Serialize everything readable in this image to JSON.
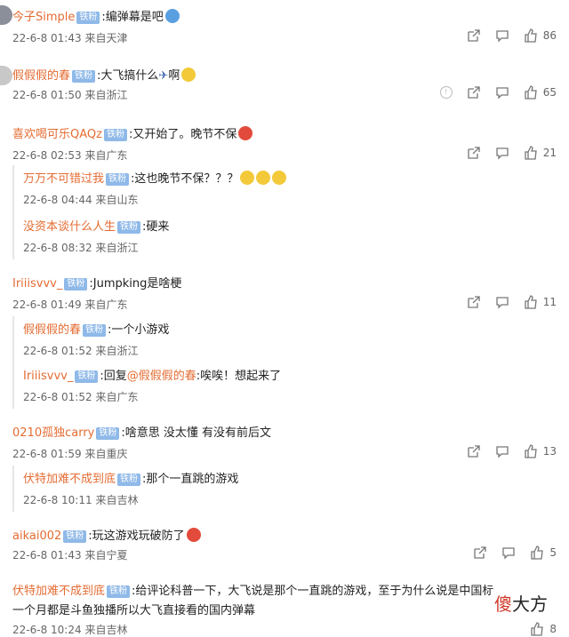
{
  "comments": [
    {
      "user": "今子Simple",
      "badge": "铁粉",
      "text": ":编弹幕是吧",
      "date": "22-6-8 01:43",
      "from": "来自天津",
      "likes": "86"
    },
    {
      "user": "假假假的春",
      "badge": "铁粉",
      "text": ":大飞搞什么",
      "text2": "啊",
      "date": "22-6-8 01:50",
      "from": "来自浙江",
      "likes": "65"
    },
    {
      "user": "喜欢喝可乐QAQz",
      "badge": "铁粉",
      "text": ":又开始了。晚节不保",
      "date": "22-6-8 02:53",
      "from": "来自广东",
      "likes": "21",
      "replies": [
        {
          "user": "万万不可错过我",
          "badge": "铁粉",
          "text": ":这也晚节不保？？？",
          "date": "22-6-8 04:44",
          "from": "来自山东"
        },
        {
          "user": "没资本谈什么人生",
          "badge": "铁粉",
          "text": ":硬来",
          "date": "22-6-8 08:32",
          "from": "来自浙江"
        }
      ]
    },
    {
      "user": "Iriiisvvv_",
      "badge": "铁粉",
      "text": ":Jumpking是啥梗",
      "date": "22-6-8 01:49",
      "from": "来自广东",
      "likes": "11",
      "replies": [
        {
          "user": "假假假的春",
          "badge": "铁粉",
          "text": ":一个小游戏",
          "date": "22-6-8 01:52",
          "from": "来自浙江"
        },
        {
          "user": "Iriiisvvv_",
          "badge": "铁粉",
          "text": ":回复",
          "mention": "@假假假的春",
          "text_after": ":唉唉！想起来了",
          "date": "22-6-8 01:52",
          "from": "来自广东"
        }
      ]
    },
    {
      "user": "0210孤独carry",
      "badge": "铁粉",
      "text": ":啥意思 没太懂 有没有前后文",
      "date": "22-6-8 01:59",
      "from": "来自重庆",
      "likes": "13",
      "replies": [
        {
          "user": "伏特加难不成到底",
          "badge": "铁粉",
          "text": ":那个一直跳的游戏",
          "date": "22-6-8 10:11",
          "from": "来自吉林"
        }
      ]
    },
    {
      "user": "aikai002",
      "badge": "铁粉",
      "text": ":玩这游戏玩破防了",
      "date": "22-6-8 01:43",
      "from": "来自宁夏",
      "likes": "5"
    },
    {
      "user": "伏特加难不成到底",
      "badge": "铁粉",
      "text": ":给评论科普一下，大飞说是那个一直跳的游戏，至于为什么说是中国标",
      "text_line2": "一个月都是斗鱼独播所以大飞直接看的国内弹幕",
      "date": "22-6-8 10:24",
      "from": "来自吉林",
      "likes": "8"
    }
  ],
  "watermark": {
    "a": "傻",
    "b": "大方"
  }
}
